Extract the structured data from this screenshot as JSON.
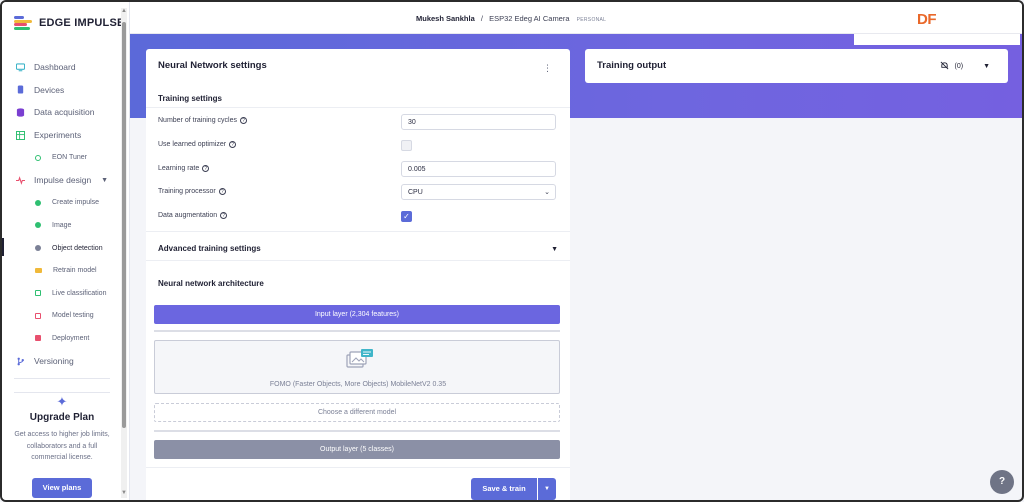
{
  "app": {
    "logo_text": "EDGE IMPULSE",
    "brand_mark": "DF"
  },
  "sidebar": {
    "items": [
      {
        "label": "Dashboard",
        "icon": "monitor-icon",
        "color": "#3fb5c9"
      },
      {
        "label": "Devices",
        "icon": "devices-icon",
        "color": "#5b6bd8"
      },
      {
        "label": "Data acquisition",
        "icon": "database-icon",
        "color": "#7a3fd1"
      },
      {
        "label": "Experiments",
        "icon": "table-icon",
        "color": "#2fbf71"
      },
      {
        "label": "EON Tuner",
        "icon": "tuner-icon",
        "color": "#2fbf71"
      },
      {
        "label": "Impulse design",
        "icon": "pulse-icon",
        "color": "#e8506e"
      },
      {
        "label": "Create impulse",
        "color": "#2fbf71"
      },
      {
        "label": "Image",
        "color": "#2fbf71"
      },
      {
        "label": "Object detection",
        "color": "#7b8096"
      },
      {
        "label": "Retrain model",
        "icon": "shuffle-icon",
        "color": "#f0b93a"
      },
      {
        "label": "Live classification",
        "icon": "live-icon",
        "color": "#2fbf71"
      },
      {
        "label": "Model testing",
        "icon": "testing-icon",
        "color": "#e8506e"
      },
      {
        "label": "Deployment",
        "icon": "deploy-icon",
        "color": "#e8506e"
      },
      {
        "label": "Versioning",
        "icon": "branch-icon",
        "color": "#5b6bd8"
      }
    ],
    "upgrade": {
      "title": "Upgrade Plan",
      "text": "Get access to higher job limits, collaborators and a full commercial license.",
      "button": "View plans"
    }
  },
  "header": {
    "user": "Mukesh Sankhla",
    "separator": "/",
    "project": "ESP32 Edeg AI Camera",
    "tag": "PERSONAL"
  },
  "nn_settings": {
    "title": "Neural Network settings",
    "training_settings_title": "Training settings",
    "fields": {
      "cycles": {
        "label": "Number of training cycles",
        "value": "30"
      },
      "optimizer": {
        "label": "Use learned optimizer",
        "checked": false
      },
      "learning_rate": {
        "label": "Learning rate",
        "value": "0.005"
      },
      "processor": {
        "label": "Training processor",
        "value": "CPU"
      },
      "augmentation": {
        "label": "Data augmentation",
        "checked": true
      }
    },
    "advanced_title": "Advanced training settings",
    "architecture_title": "Neural network architecture",
    "input_layer": "Input layer (2,304 features)",
    "model_name": "FOMO (Faster Objects, More Objects) MobileNetV2 0.35",
    "choose_model": "Choose a different model",
    "output_layer": "Output layer (5 classes)",
    "save_train": "Save & train"
  },
  "training_output": {
    "title": "Training output",
    "notification_count": "(0)"
  },
  "help": "?"
}
